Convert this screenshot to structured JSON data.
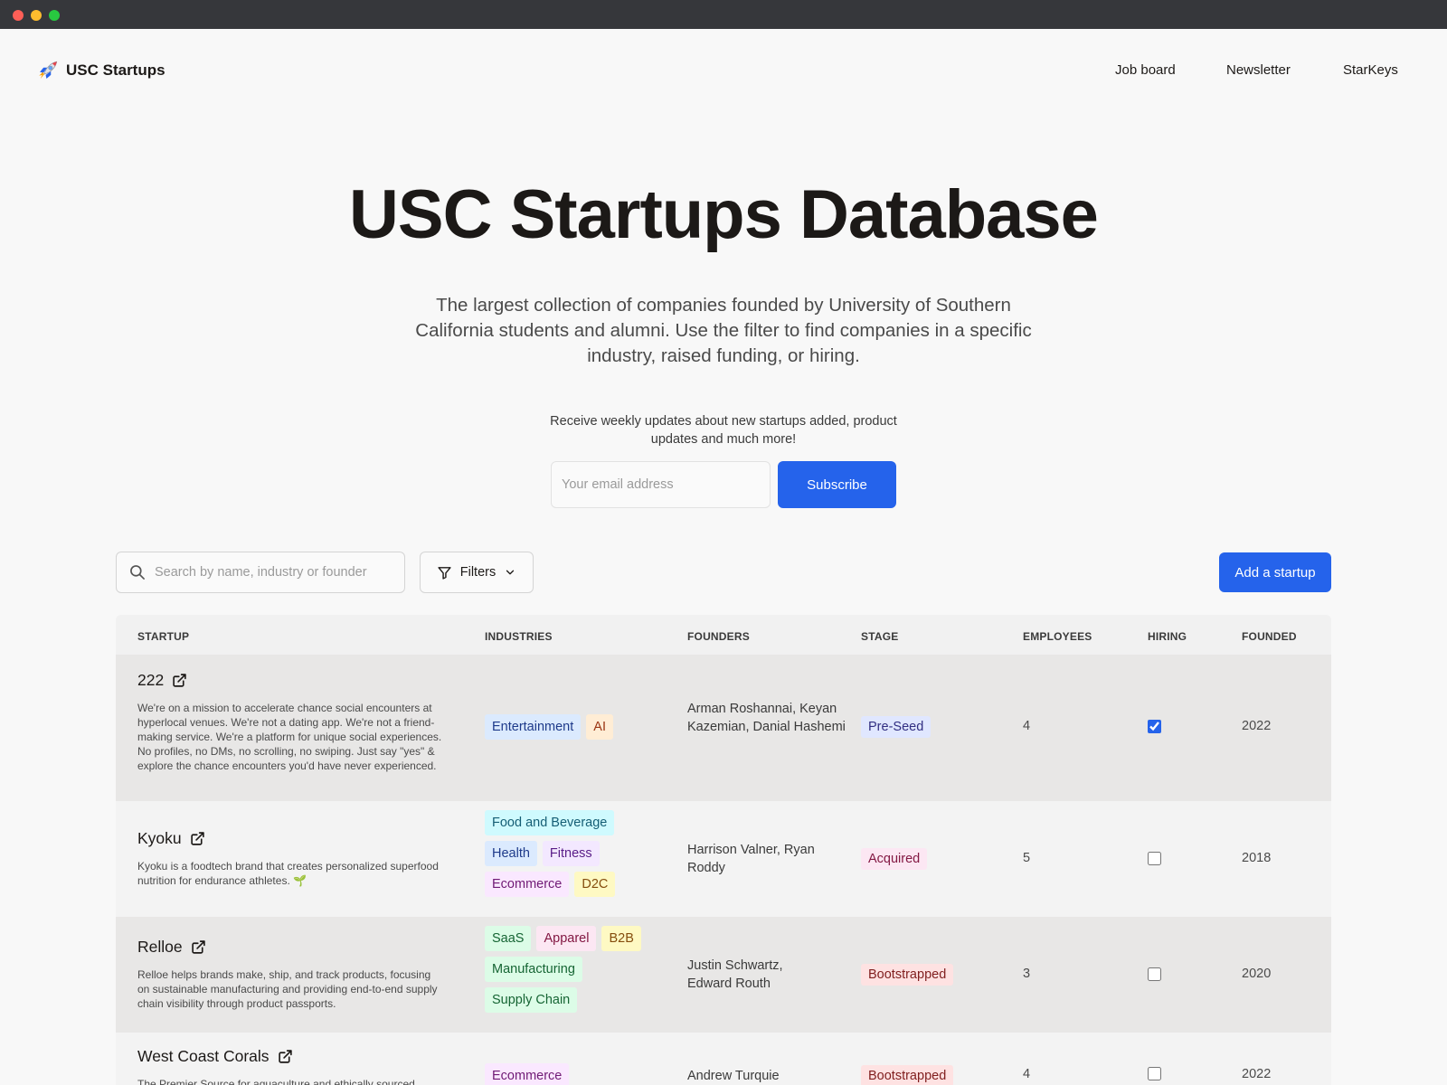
{
  "brand": {
    "icon": "rocket-icon",
    "name": "USC Startups"
  },
  "nav": {
    "links": [
      "Job board",
      "Newsletter",
      "StarKeys"
    ]
  },
  "hero": {
    "title": "USC Startups Database",
    "subtitle": "The largest collection of companies founded by University of Southern California students and alumni. Use the filter to find companies in a specific industry, raised funding, or hiring."
  },
  "newsletter": {
    "text": "Receive weekly updates about new startups added, product updates and much more!",
    "email_placeholder": "Your email address",
    "subscribe_label": "Subscribe"
  },
  "toolbar": {
    "search_placeholder": "Search by name, industry or founder",
    "filters_label": "Filters",
    "add_label": "Add a startup"
  },
  "table": {
    "columns": [
      "STARTUP",
      "INDUSTRIES",
      "FOUNDERS",
      "STAGE",
      "EMPLOYEES",
      "HIRING",
      "FOUNDED"
    ],
    "rows": [
      {
        "name": "222",
        "description": "We're on a mission to accelerate chance social encounters at hyperlocal venues. We're not a dating app. We're not a friend-making service. We're a platform for unique social experiences. No profiles, no DMs, no scrolling, no swiping. Just say \"yes\" & explore the chance encounters you'd have never experienced.",
        "industries": [
          "Entertainment",
          "AI"
        ],
        "founders": "Arman Roshannai, Keyan Kazemian, Danial Hashemi",
        "stage": "Pre-Seed",
        "employees": "4",
        "hiring": true,
        "founded": "2022"
      },
      {
        "name": "Kyoku",
        "description": "Kyoku is a foodtech brand that creates personalized superfood nutrition for endurance athletes. 🌱",
        "industries": [
          "Food and Beverage",
          "Health",
          "Fitness",
          "Ecommerce",
          "D2C"
        ],
        "founders": "Harrison Valner, Ryan Roddy",
        "stage": "Acquired",
        "employees": "5",
        "hiring": false,
        "founded": "2018"
      },
      {
        "name": "Relloe",
        "description": "Relloe helps brands make, ship, and track products, focusing on sustainable manufacturing and providing end-to-end supply chain visibility through product passports.",
        "industries": [
          "SaaS",
          "Apparel",
          "B2B",
          "Manufacturing",
          "Supply Chain"
        ],
        "founders": "Justin Schwartz, Edward Routh",
        "stage": "Bootstrapped",
        "employees": "3",
        "hiring": false,
        "founded": "2020"
      },
      {
        "name": "West Coast Corals",
        "description": "The Premier Source for aquaculture and ethically sourced",
        "industries": [
          "Ecommerce"
        ],
        "founders": "Andrew Turquie",
        "stage": "Bootstrapped",
        "employees": "4",
        "hiring": false,
        "founded": "2022"
      }
    ]
  },
  "colors": {
    "accent": "#2563eb",
    "page_bg": "#f8f8f8",
    "titlebar": "#36373b",
    "tag_entertainment": "#dbeafe",
    "tag_ai": "#ffedd5",
    "tag_food": "#cffafe",
    "tag_health": "#dbeafe",
    "tag_fitness": "#f3e8ff",
    "tag_ecommerce": "#fae8ff",
    "tag_d2c": "#fef9c3",
    "tag_saas": "#dcfce7",
    "tag_apparel": "#fce7f3",
    "tag_b2b": "#fef9c3",
    "tag_manufacturing": "#dcfce7",
    "tag_supply_chain": "#dcfce7",
    "stage_preseed": "#e0e7ff",
    "stage_acquired": "#fce7f3",
    "stage_bootstrapped": "#fee2e2"
  }
}
